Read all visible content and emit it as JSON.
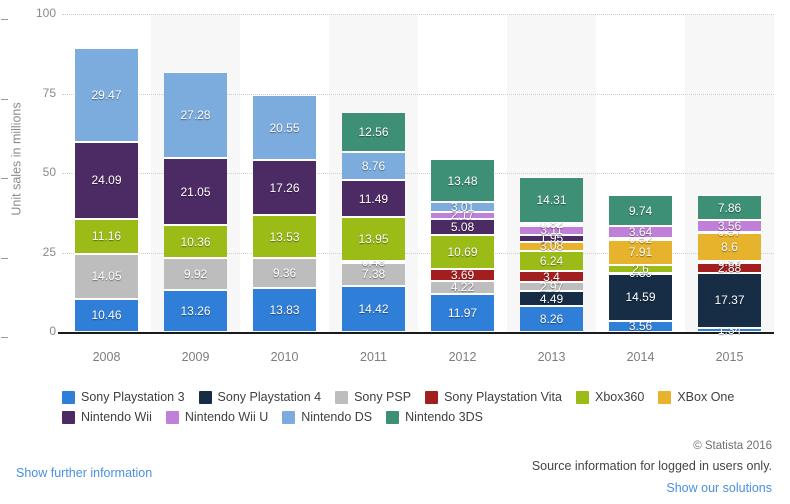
{
  "chart_data": {
    "type": "bar",
    "subtype": "stacked-bar",
    "title": "",
    "xlabel": "",
    "ylabel": "Unit sales in millions",
    "categories": [
      "2008",
      "2009",
      "2010",
      "2011",
      "2012",
      "2013",
      "2014",
      "2015"
    ],
    "ylim": [
      0,
      100
    ],
    "yticks": [
      "0",
      "25",
      "50",
      "75",
      "100"
    ],
    "ytick_values": [
      0,
      25,
      50,
      75,
      100
    ],
    "grid": true,
    "legend_position": "bottom",
    "series": [
      {
        "name": "Sony Playstation 3",
        "color": "#2f7ed8",
        "values": [
          10.46,
          13.26,
          13.83,
          14.42,
          11.97,
          8.26,
          3.56,
          1.34
        ],
        "labels": [
          "10.46",
          "13.26",
          "13.83",
          "14.42",
          "11.97",
          "8.26",
          "3.56",
          "1.34"
        ]
      },
      {
        "name": "Sony Playstation 4",
        "color": "#162d45",
        "values": [
          0,
          0,
          0,
          0,
          0,
          4.49,
          14.59,
          17.37
        ],
        "labels": [
          "",
          "",
          "",
          "",
          "",
          "4.49",
          "14.59",
          "17.37"
        ]
      },
      {
        "name": "Sony PSP",
        "color": "#bdbdbd",
        "values": [
          14.05,
          9.92,
          9.36,
          7.38,
          4.22,
          2.97,
          0,
          0
        ],
        "labels": [
          "14.05",
          "9.92",
          "9.36",
          "7.38",
          "4.22",
          "2.97",
          "",
          ""
        ]
      },
      {
        "name": "Sony Playstation Vita",
        "color": "#a31e1e",
        "values": [
          0,
          0,
          0,
          0.48,
          3.69,
          3.4,
          0.39,
          2.88
        ],
        "labels": [
          "",
          "",
          "",
          "0.48",
          "3.69",
          "3.4",
          "0.39",
          "2.88"
        ]
      },
      {
        "name": "Xbox360",
        "color": "#9bbb17",
        "values": [
          11.16,
          10.36,
          13.53,
          13.95,
          10.69,
          6.24,
          2.6,
          0.83
        ],
        "labels": [
          "11.16",
          "10.36",
          "13.53",
          "13.95",
          "10.69",
          "6.24",
          "2.6",
          "0.83"
        ]
      },
      {
        "name": "XBox One",
        "color": "#e8b32c",
        "values": [
          0,
          0,
          0,
          0,
          0,
          3.08,
          7.91,
          8.6
        ],
        "labels": [
          "",
          "",
          "",
          "",
          "",
          "3.08",
          "7.91",
          "8.6"
        ]
      },
      {
        "name": "Nintendo Wii",
        "color": "#4c2a63",
        "values": [
          24.09,
          21.05,
          17.26,
          11.49,
          5.08,
          1.95,
          0.52,
          0.57
        ],
        "labels": [
          "24.09",
          "21.05",
          "17.26",
          "11.49",
          "5.08",
          "1.95",
          "0.52",
          "0.57"
        ]
      },
      {
        "name": "Nintendo Wii U",
        "color": "#c07fd8",
        "values": [
          0,
          0,
          0,
          0,
          2.17,
          3.11,
          3.64,
          3.56
        ],
        "labels": [
          "",
          "",
          "",
          "",
          "2.17",
          "3.11",
          "3.64",
          "3.56"
        ]
      },
      {
        "name": "Nintendo DS",
        "color": "#7cacde",
        "values": [
          29.47,
          27.28,
          20.55,
          8.76,
          3.01,
          0.82,
          0,
          0
        ],
        "labels": [
          "29.47",
          "27.28",
          "20.55",
          "8.76",
          "3.01",
          "0.82",
          "",
          ""
        ]
      },
      {
        "name": "Nintendo 3DS",
        "color": "#3d8f75",
        "values": [
          0,
          0,
          0,
          12.56,
          13.48,
          14.31,
          9.74,
          7.86
        ],
        "labels": [
          "",
          "",
          "",
          "12.56",
          "13.48",
          "14.31",
          "9.74",
          "7.86"
        ]
      }
    ]
  },
  "legend": {
    "items": [
      {
        "label": "Sony Playstation 3",
        "color": "#2f7ed8"
      },
      {
        "label": "Sony Playstation 4",
        "color": "#162d45"
      },
      {
        "label": "Sony PSP",
        "color": "#bdbdbd"
      },
      {
        "label": "Sony Playstation Vita",
        "color": "#a31e1e"
      },
      {
        "label": "Xbox360",
        "color": "#9bbb17"
      },
      {
        "label": "XBox One",
        "color": "#e8b32c"
      },
      {
        "label": "Nintendo Wii",
        "color": "#4c2a63"
      },
      {
        "label": "Nintendo Wii U",
        "color": "#c07fd8"
      },
      {
        "label": "Nintendo DS",
        "color": "#7cacde"
      },
      {
        "label": "Nintendo 3DS",
        "color": "#3d8f75"
      }
    ]
  },
  "footer": {
    "copyright": "© Statista 2016",
    "source": "Source information for logged in users only.",
    "solutions_link": "Show our solutions",
    "further_link": "Show further information"
  },
  "colors": {
    "grid": "#cfcfcf",
    "band": "#f7f7f7",
    "axis": "#1a1a1a",
    "tick_text": "#8a8a8a",
    "link": "#4a90e2"
  }
}
